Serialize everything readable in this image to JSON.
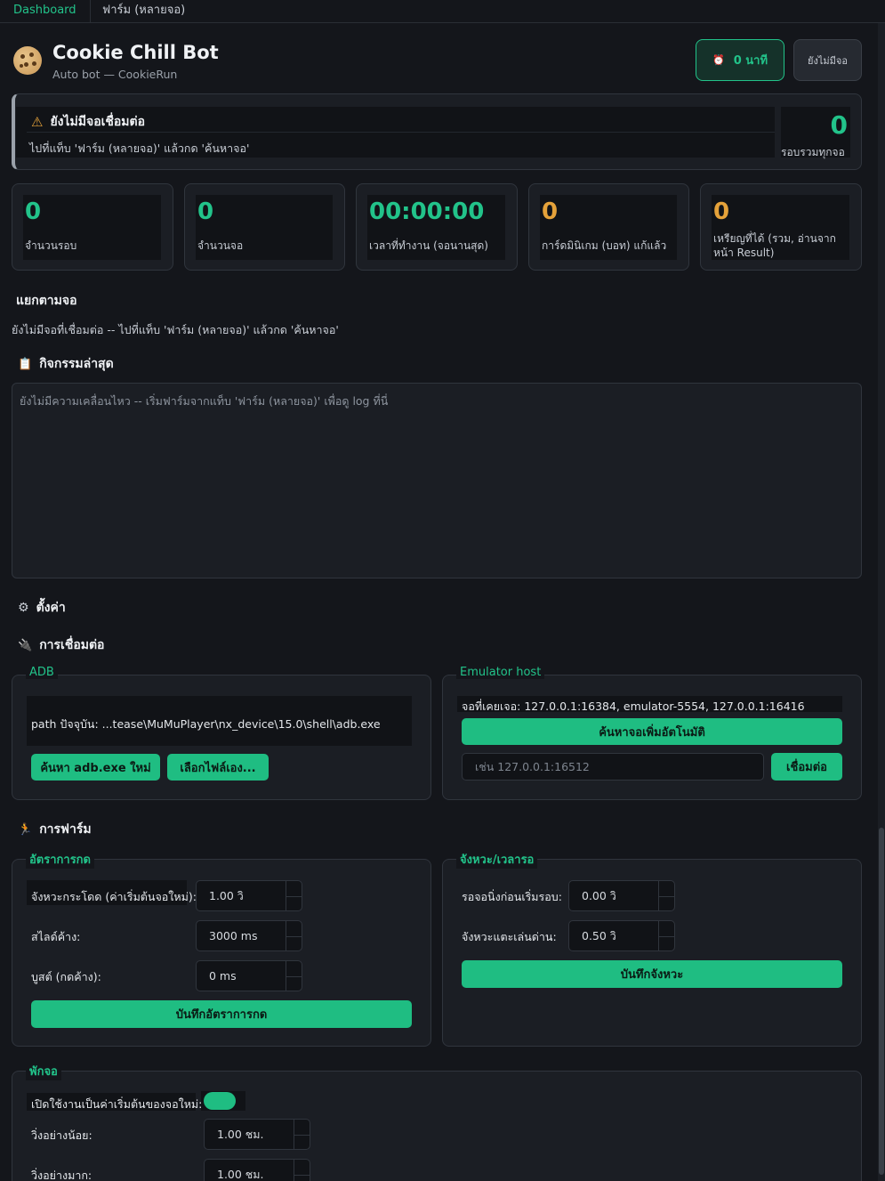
{
  "tabs": [
    {
      "label": "Dashboard"
    },
    {
      "label": "ฟาร์ม (หลายจอ)"
    }
  ],
  "header": {
    "title": "Cookie Chill Bot",
    "subtitle": "Auto bot — CookieRun",
    "minutes_button": "0 นาที",
    "device_button": "ยังไม่มีจอ"
  },
  "status": {
    "title": "ยังไม่มีจอเชื่อมต่อ",
    "message": "ไปที่แท็บ 'ฟาร์ม (หลายจอ)' แล้วกด 'ค้นหาจอ'",
    "total": "0",
    "total_label": "รอบรวมทุกจอ"
  },
  "stats": [
    {
      "value": "0",
      "label": "จำนวนรอบ",
      "color": "#22c38a"
    },
    {
      "value": "0",
      "label": "จำนวนจอ",
      "color": "#22c38a"
    },
    {
      "value": "00:00:00",
      "label": "เวลาที่ทำงาน (จอนานสุด)",
      "color": "#22c38a"
    },
    {
      "value": "0",
      "label": "การ์ดมินิเกม (บอท) แก้แล้ว",
      "color": "#e5a23a"
    },
    {
      "value": "0",
      "label": "เหรียญที่ได้ (รวม, อ่านจากหน้า Result)",
      "color": "#e5a23a"
    }
  ],
  "per_screen": {
    "heading": "แยกตามจอ",
    "message": "ยังไม่มีจอที่เชื่อมต่อ -- ไปที่แท็บ 'ฟาร์ม (หลายจอ)' แล้วกด 'ค้นหาจอ'"
  },
  "activity": {
    "heading": "กิจกรรมล่าสุด",
    "empty": "ยังไม่มีความเคลื่อนไหว -- เริ่มฟาร์มจากแท็บ 'ฟาร์ม (หลายจอ)' เพื่อดู log ที่นี่"
  },
  "settings": {
    "heading": "ตั้งค่า",
    "connection_heading": "การเชื่อมต่อ",
    "adb": {
      "legend": "ADB",
      "path": "path ปัจจุบัน: ...tease\\MuMuPlayer\\nx_device\\15.0\\shell\\adb.exe",
      "find_button": "ค้นหา adb.exe ใหม่",
      "choose_button": "เลือกไฟล์เอง..."
    },
    "emulator": {
      "legend": "Emulator host",
      "seen": "จอที่เคยเจอ: 127.0.0.1:16384, emulator-5554, 127.0.0.1:16416",
      "auto_button": "ค้นหาจอเพิ่มอัตโนมัติ",
      "host_placeholder": "เช่น 127.0.0.1:16512",
      "connect_button": "เชื่อมต่อ"
    },
    "farm_heading": "การฟาร์ม",
    "tap_rate": {
      "legend": "อัตราการกด",
      "fields": [
        {
          "label": "จังหวะกระโดด (ค่าเริ่มต้นจอใหม่):",
          "value": "1.00 วิ"
        },
        {
          "label": "สไลด์ค้าง:",
          "value": "3000 ms"
        },
        {
          "label": "บูสต์ (กดค้าง):",
          "value": "0 ms"
        }
      ],
      "save_button": "บันทึกอัตราการกด"
    },
    "timing": {
      "legend": "จังหวะ/เวลารอ",
      "fields": [
        {
          "label": "รอจอนิ่งก่อนเริ่มรอบ:",
          "value": "0.00 วิ"
        },
        {
          "label": "จังหวะแตะเล่นด่าน:",
          "value": "0.50 วิ"
        }
      ],
      "save_button": "บันทึกจังหวะ"
    },
    "rest": {
      "legend": "พักจอ",
      "toggle_label": "เปิดใช้งานเป็นค่าเริ่มต้นของจอใหม่:",
      "toggle_on": true,
      "fields": [
        {
          "label": "วิ่งอย่างน้อย:",
          "value": "1.00 ชม."
        },
        {
          "label": "วิ่งอย่างมาก:",
          "value": "1.00 ชม."
        }
      ]
    }
  },
  "colors": {
    "accent": "#22c38a",
    "warning": "#e5a23a",
    "background": "#14161b"
  }
}
